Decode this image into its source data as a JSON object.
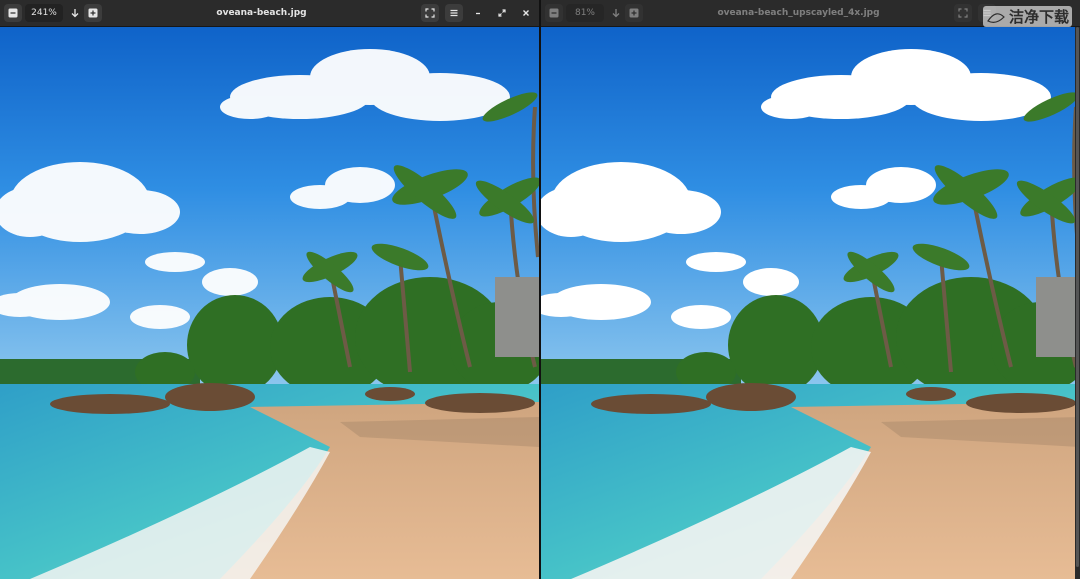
{
  "left_window": {
    "zoom_out_icon": "minus-square",
    "zoom_level": "241%",
    "zoom_fit_icon": "arrow-down",
    "zoom_in_icon": "plus-square",
    "filename": "oveana-beach.jpg",
    "fullscreen_icon": "fullscreen",
    "menu_icon": "hamburger",
    "minimize_icon": "minimize",
    "maximize_icon": "maximize",
    "close_icon": "close"
  },
  "right_window": {
    "zoom_out_icon": "minus-square",
    "zoom_level": "81%",
    "zoom_fit_icon": "arrow-down",
    "zoom_in_icon": "plus-square",
    "filename": "oveana-beach_upscayled_4x.jpg",
    "fullscreen_icon": "fullscreen",
    "menu_icon": "hamburger"
  },
  "watermark": {
    "text": "洁净下载"
  },
  "colors": {
    "headerbar": "#2b2b2b",
    "sky_top": "#0f63c9",
    "sky_bottom": "#6fb3ea",
    "sea": "#38b2c6",
    "sand": "#e2b68f"
  }
}
